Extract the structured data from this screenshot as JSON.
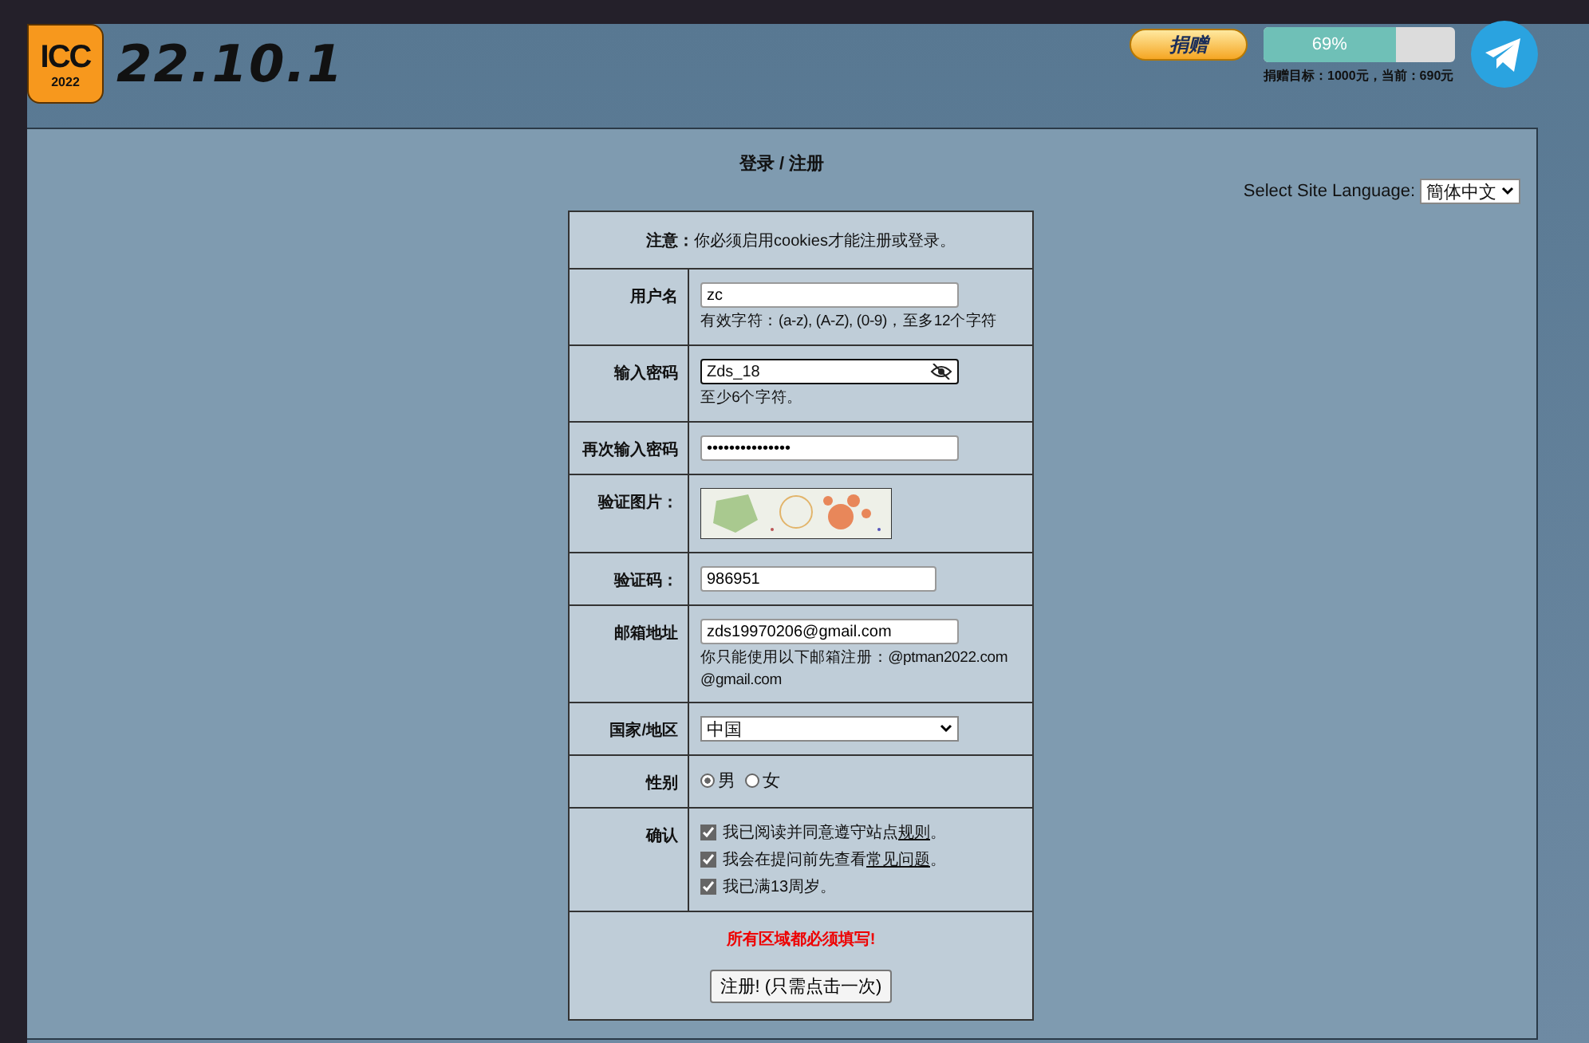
{
  "header": {
    "logo_text": "ICC",
    "logo_year": "2022",
    "version": "22.10.1",
    "donate_button": "捐赠",
    "donation": {
      "level": 0.69,
      "percent": "69%",
      "goal": "捐赠目标：1000元，当前：690元"
    }
  },
  "page": {
    "title": "登录 / 注册",
    "language_label": "Select Site Language:",
    "language": "簡体中文"
  },
  "notice": {
    "label": "注意：",
    "text": "你必须启用cookies才能注册或登录。"
  },
  "rows": [
    {
      "label": "用户名",
      "kind": "input",
      "value": "zc",
      "hints": [
        "有效字符：(a-z), (A-Z), (0-9)，至多12个字符"
      ]
    },
    {
      "label": "输入密码",
      "kind": "password",
      "value": "Zds_18",
      "hints": [
        "至少6个字符。"
      ]
    },
    {
      "label": "再次输入密码",
      "kind": "input",
      "value": "•••••••••••••••",
      "hints": []
    },
    {
      "label": "验证图片：",
      "kind": "captcha"
    },
    {
      "label": "验证码：",
      "kind": "short_input",
      "value": "986951",
      "hints": []
    },
    {
      "label": "邮箱地址",
      "kind": "input",
      "value": "zds19970206@gmail.com",
      "hints": [
        "你只能使用以下邮箱注册：@ptman2022.com",
        "@gmail.com"
      ]
    },
    {
      "label": "国家/地区",
      "kind": "select",
      "value": "中国"
    },
    {
      "label": "性别",
      "kind": "radio",
      "options": [
        {
          "label": "男",
          "selected": true
        },
        {
          "label": "女",
          "selected": false
        }
      ]
    },
    {
      "label": "确认",
      "kind": "checks",
      "items": [
        {
          "before": "我已阅读并同意遵守站点",
          "link": "规则",
          "after": "。",
          "checked": true
        },
        {
          "before": "我会在提问前先查看",
          "link": "常见问题",
          "after": "。",
          "checked": true
        },
        {
          "before": "我已满13周岁。",
          "checked": true
        }
      ]
    }
  ],
  "footer": {
    "warning": "所有区域都必须填写!",
    "submit": "注册! (只需点击一次)"
  }
}
